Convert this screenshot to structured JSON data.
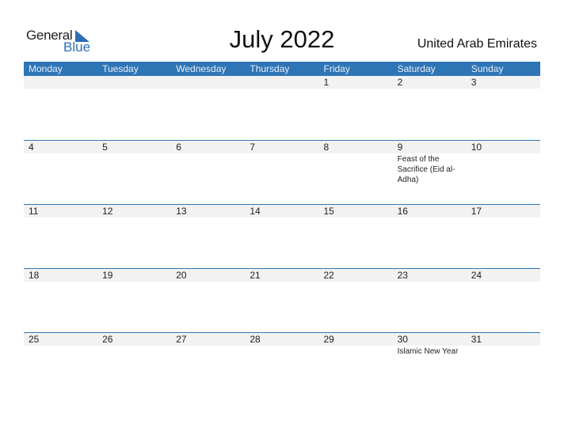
{
  "logo": {
    "general": "General",
    "blue": "Blue"
  },
  "title": "July 2022",
  "country": "United Arab Emirates",
  "colors": {
    "accent": "#2e75b6",
    "strip": "#f2f2f2"
  },
  "weekdays": [
    "Monday",
    "Tuesday",
    "Wednesday",
    "Thursday",
    "Friday",
    "Saturday",
    "Sunday"
  ],
  "weeks": [
    [
      {
        "d": ""
      },
      {
        "d": ""
      },
      {
        "d": ""
      },
      {
        "d": ""
      },
      {
        "d": "1"
      },
      {
        "d": "2"
      },
      {
        "d": "3"
      }
    ],
    [
      {
        "d": "4"
      },
      {
        "d": "5"
      },
      {
        "d": "6"
      },
      {
        "d": "7"
      },
      {
        "d": "8"
      },
      {
        "d": "9",
        "event": "Feast of the Sacrifice (Eid al-Adha)"
      },
      {
        "d": "10"
      }
    ],
    [
      {
        "d": "11"
      },
      {
        "d": "12"
      },
      {
        "d": "13"
      },
      {
        "d": "14"
      },
      {
        "d": "15"
      },
      {
        "d": "16"
      },
      {
        "d": "17"
      }
    ],
    [
      {
        "d": "18"
      },
      {
        "d": "19"
      },
      {
        "d": "20"
      },
      {
        "d": "21"
      },
      {
        "d": "22"
      },
      {
        "d": "23"
      },
      {
        "d": "24"
      }
    ],
    [
      {
        "d": "25"
      },
      {
        "d": "26"
      },
      {
        "d": "27"
      },
      {
        "d": "28"
      },
      {
        "d": "29"
      },
      {
        "d": "30",
        "event": "Islamic New Year"
      },
      {
        "d": "31"
      }
    ]
  ]
}
